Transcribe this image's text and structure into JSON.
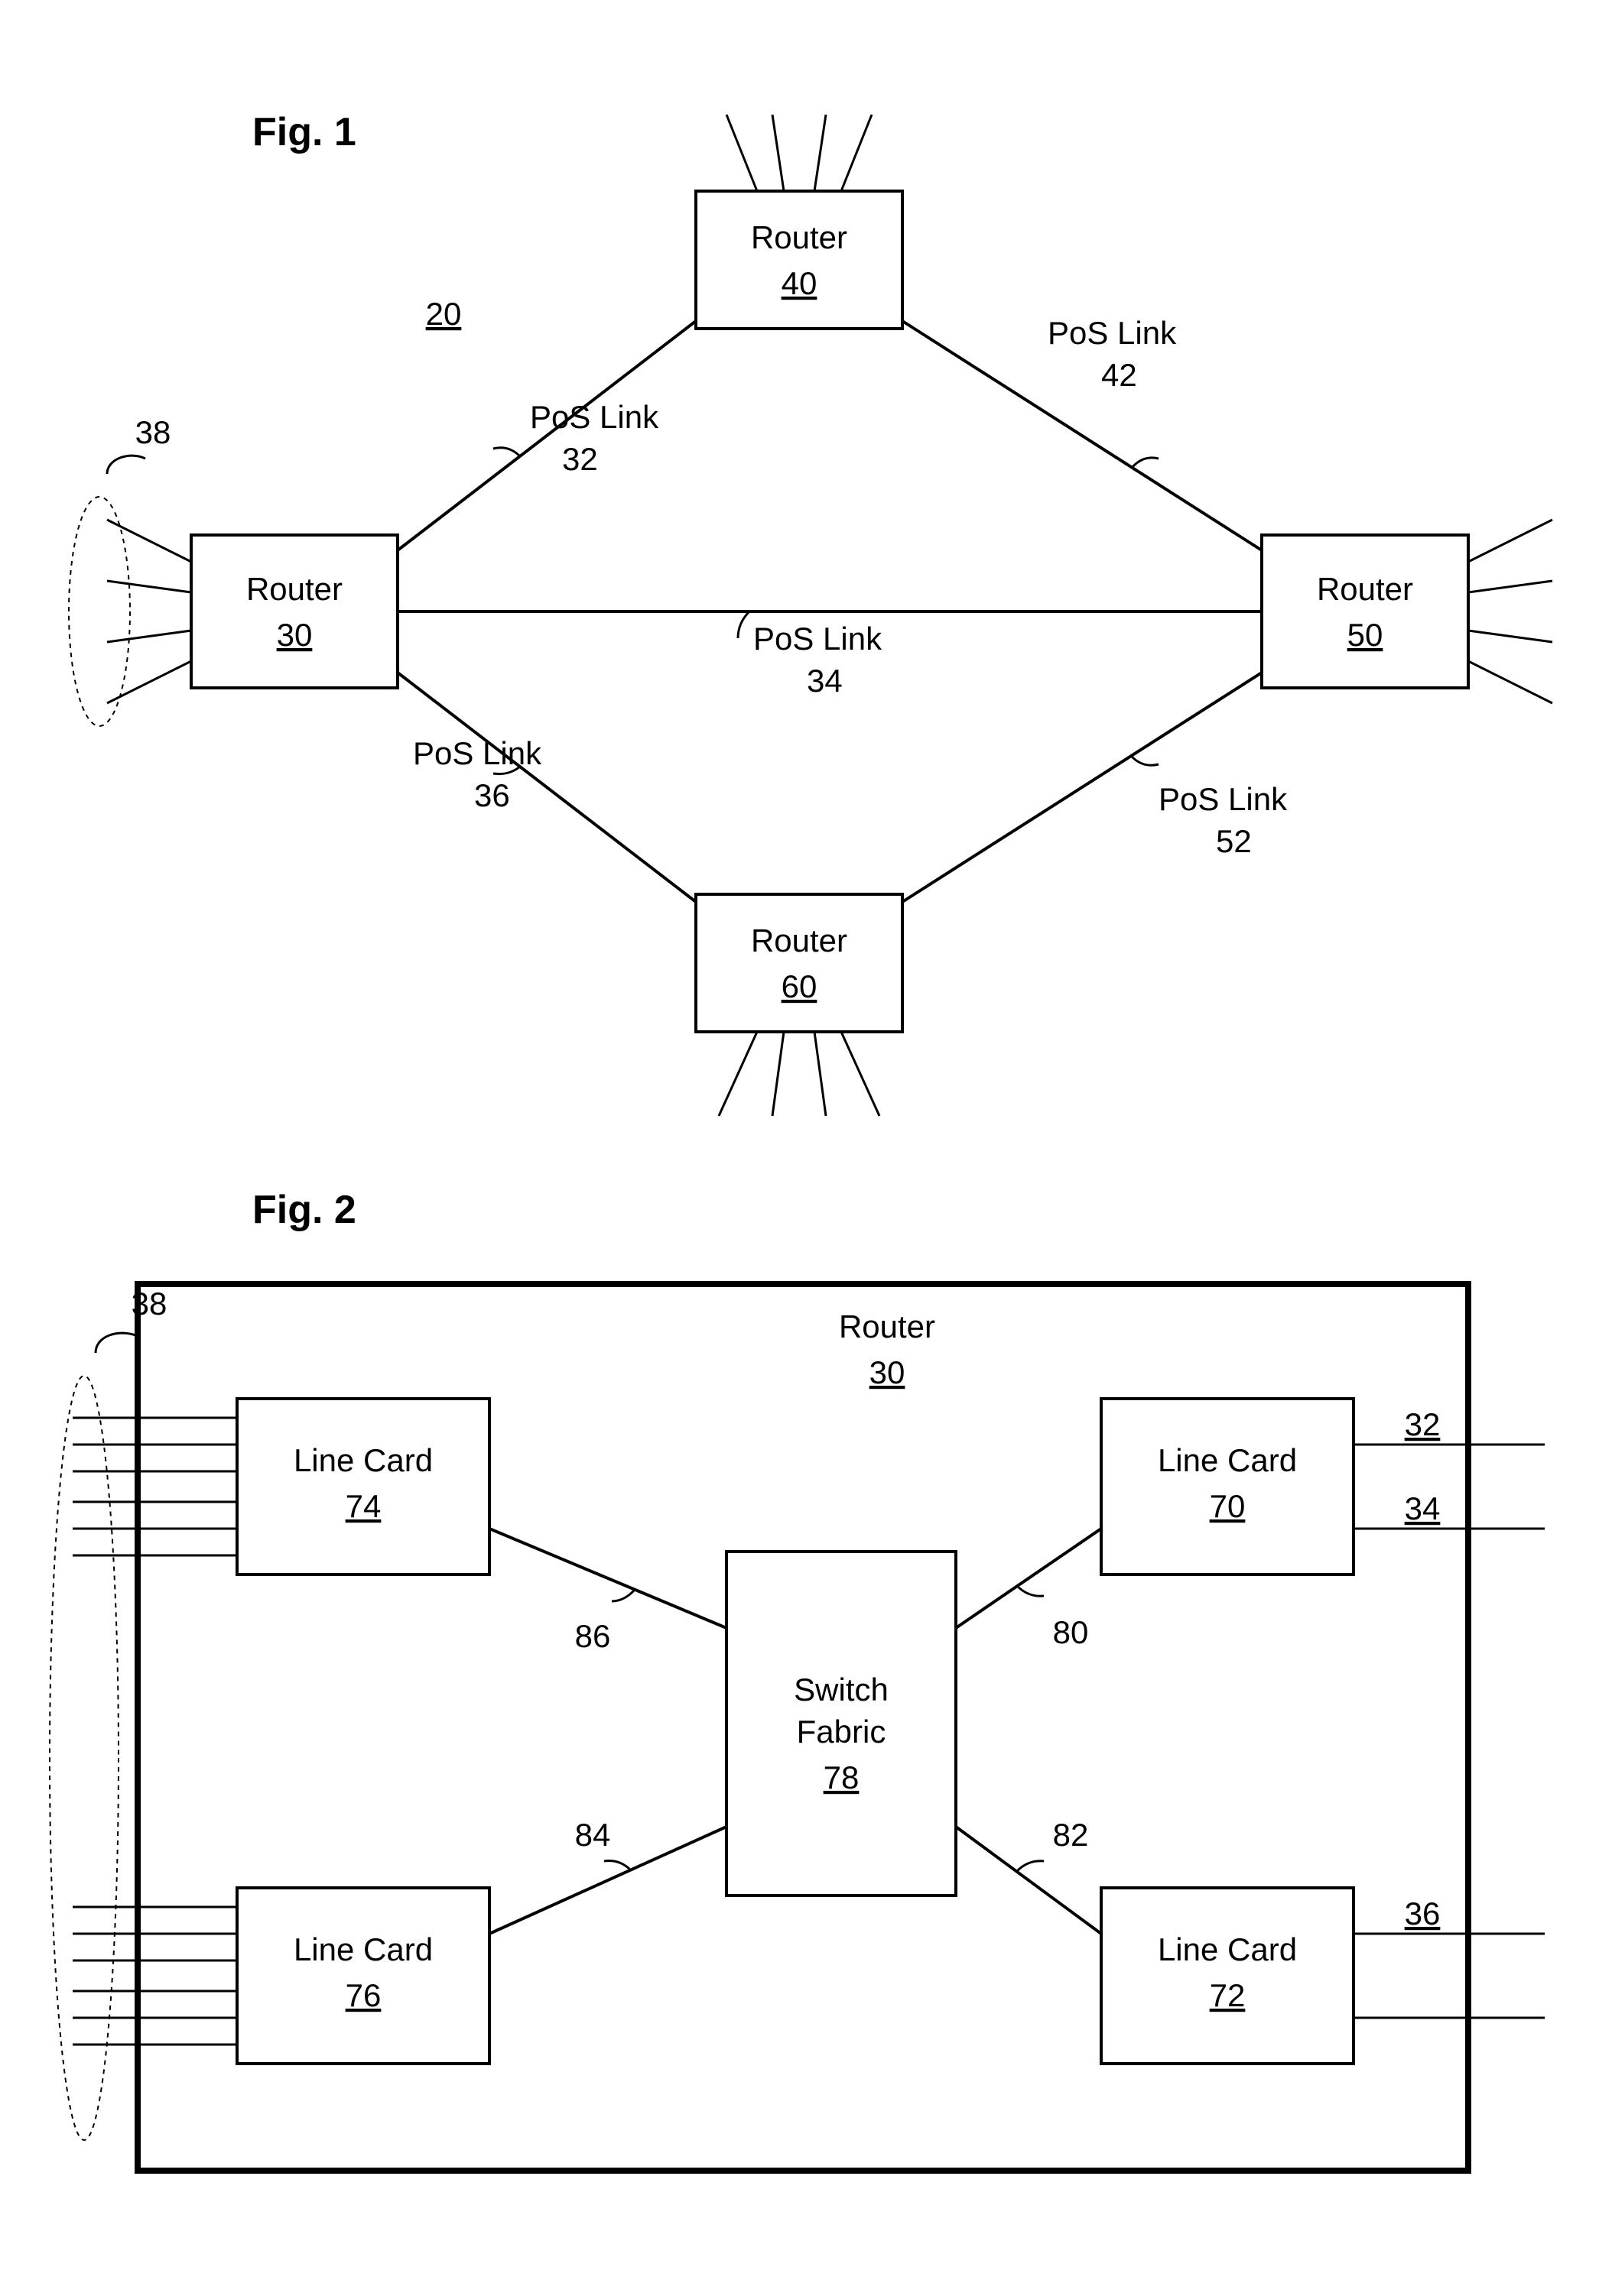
{
  "figures": {
    "fig1": {
      "title": "Fig. 1",
      "system_ref": "20",
      "ellipse_ref": "38"
    },
    "fig2": {
      "title": "Fig. 2",
      "ellipse_ref": "38"
    }
  },
  "routers": {
    "r30": {
      "label": "Router",
      "ref": "30"
    },
    "r40": {
      "label": "Router",
      "ref": "40"
    },
    "r50": {
      "label": "Router",
      "ref": "50"
    },
    "r60": {
      "label": "Router",
      "ref": "60"
    }
  },
  "links": {
    "l32": {
      "label": "PoS Link",
      "ref": "32"
    },
    "l34": {
      "label": "PoS Link",
      "ref": "34"
    },
    "l36": {
      "label": "PoS Link",
      "ref": "36"
    },
    "l42": {
      "label": "PoS Link",
      "ref": "42"
    },
    "l52": {
      "label": "PoS Link",
      "ref": "52"
    }
  },
  "fig2_parts": {
    "router_label": "Router",
    "router_ref": "30",
    "switch_label1": "Switch",
    "switch_label2": "Fabric",
    "switch_ref": "78",
    "lc70": {
      "label": "Line Card",
      "ref": "70"
    },
    "lc72": {
      "label": "Line Card",
      "ref": "72"
    },
    "lc74": {
      "label": "Line Card",
      "ref": "74"
    },
    "lc76": {
      "label": "Line Card",
      "ref": "76"
    },
    "conn80": "80",
    "conn82": "82",
    "conn84": "84",
    "conn86": "86",
    "out32": "32",
    "out34": "34",
    "out36": "36"
  }
}
